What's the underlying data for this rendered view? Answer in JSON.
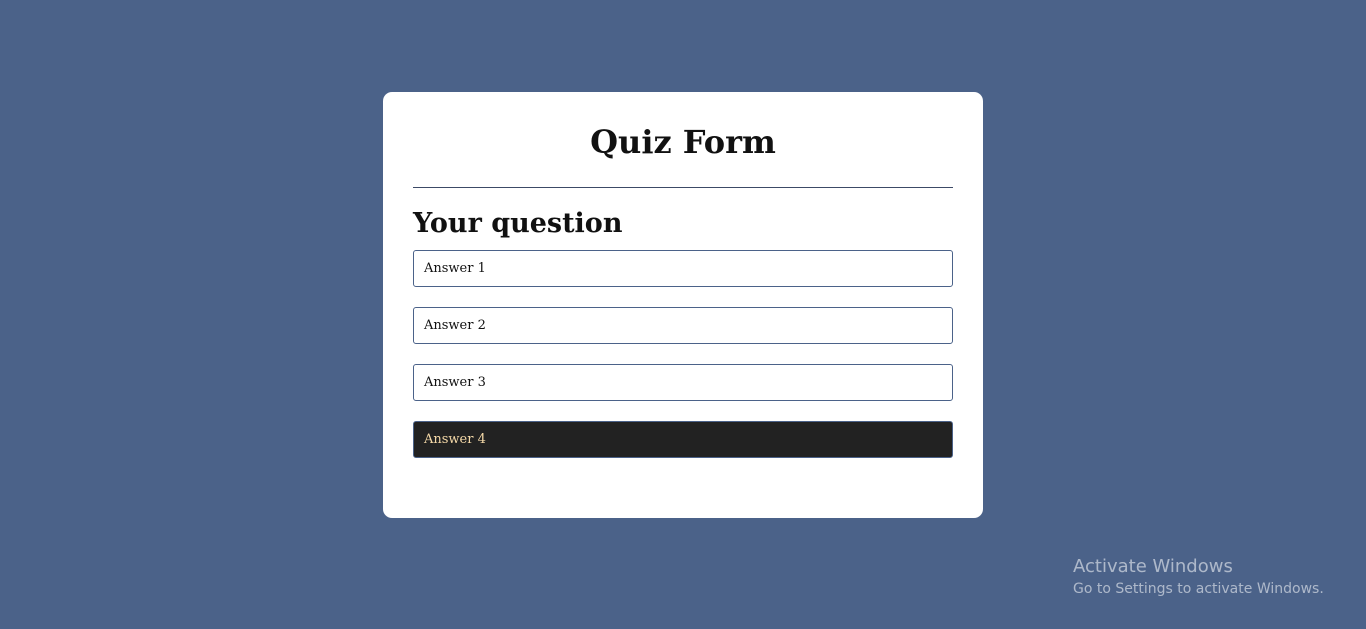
{
  "quiz": {
    "title": "Quiz Form",
    "question": "Your question",
    "answers": [
      {
        "label": "Answer 1",
        "selected": false
      },
      {
        "label": "Answer 2",
        "selected": false
      },
      {
        "label": "Answer 3",
        "selected": false
      },
      {
        "label": "Answer 4",
        "selected": true
      }
    ]
  },
  "watermark": {
    "title": "Activate Windows",
    "subtitle": "Go to Settings to activate Windows."
  },
  "colors": {
    "background": "#4b6289",
    "card": "#ffffff",
    "selected_background": "#222222",
    "selected_text": "#f5d9a8",
    "answer_border": "#4b6289"
  }
}
